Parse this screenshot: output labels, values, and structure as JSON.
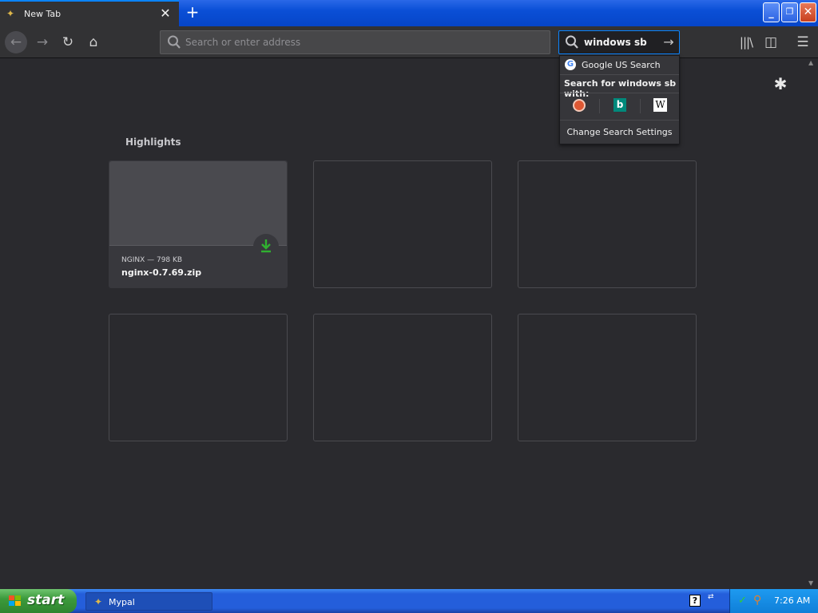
{
  "tab": {
    "title": "New Tab",
    "close_glyph": "✕"
  },
  "newtab_glyph": "+",
  "window_buttons": {
    "minimize": "_",
    "maximize": "❐",
    "close": "✕"
  },
  "nav": {
    "back_glyph": "←",
    "forward_glyph": "→",
    "reload_glyph": "↻",
    "home_glyph": "⌂",
    "url_placeholder": "Search or enter address",
    "search_value": "windows sb",
    "search_go_glyph": "→",
    "library_glyph": "|||\\",
    "sidebar_glyph": "◫",
    "menu_glyph": "☰"
  },
  "search_popup": {
    "engine_logo": "G",
    "engine": "Google US Search",
    "search_with": "Search for windows sb with:",
    "engines": [
      "duckduckgo-icon",
      "bing-icon",
      "wikipedia-icon"
    ],
    "bing_glyph": "b",
    "wiki_glyph": "W",
    "settings": "Change Search Settings"
  },
  "content": {
    "gear_glyph": "✱",
    "highlights_title": "Highlights",
    "cards": [
      {
        "meta": "NGINX — 798 KB",
        "filename": "nginx-0.7.69.zip",
        "badge": "download-icon"
      }
    ]
  },
  "taskbar": {
    "start": "start",
    "task": "Mypal",
    "help_glyph": "?",
    "sync_glyph": "⇄",
    "clock": "7:26 AM"
  },
  "colors": {
    "accent": "#0a84ff",
    "background": "#2a2a2e",
    "toolbar": "#323234",
    "download_green": "#30b030"
  }
}
